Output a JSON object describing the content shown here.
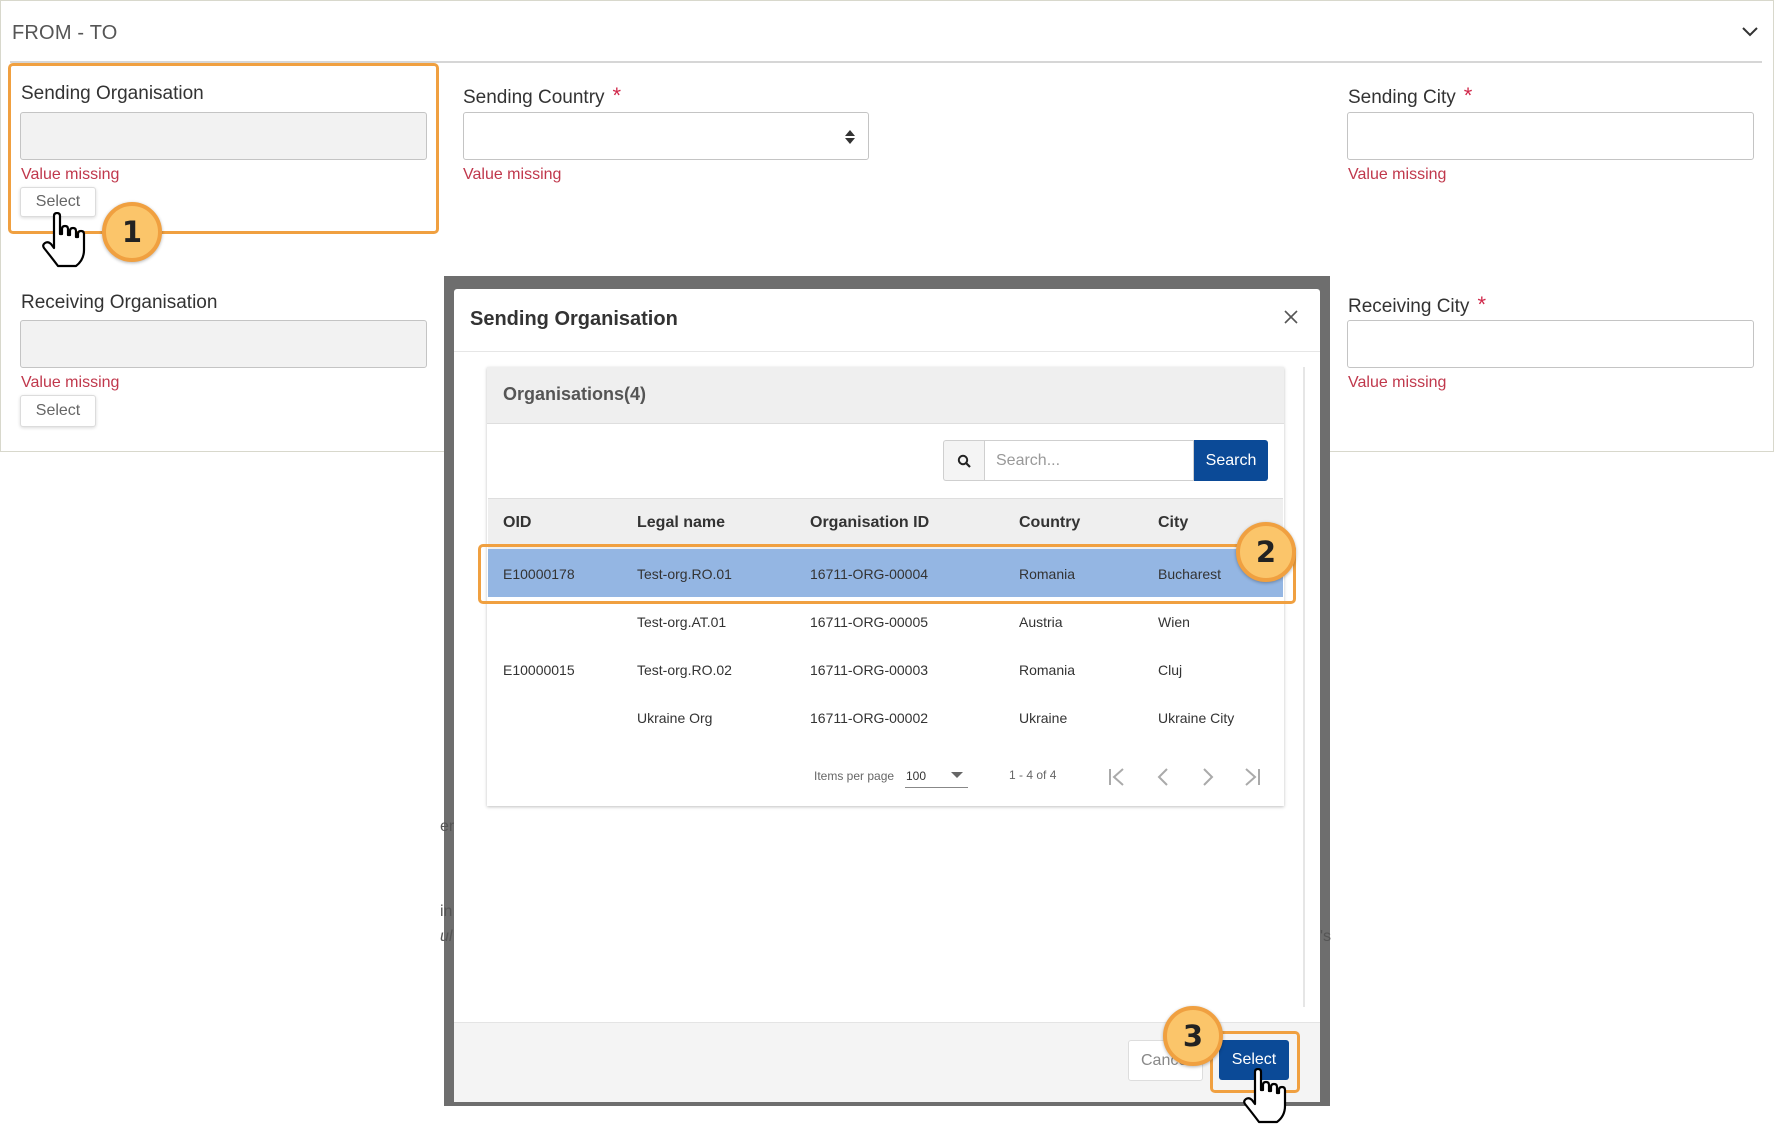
{
  "panel": {
    "title": "FROM - TO",
    "collapse_icon": "chevron-down-icon",
    "fields": {
      "sending_organisation": {
        "label": "Sending Organisation",
        "value": "",
        "error": "Value missing",
        "button": "Select"
      },
      "sending_country": {
        "label": "Sending Country",
        "required": "*",
        "value": "",
        "error": "Value missing"
      },
      "sending_city": {
        "label": "Sending City",
        "required": "*",
        "value": "",
        "error": "Value missing"
      },
      "receiving_organisation": {
        "label": "Receiving Organisation",
        "value": "",
        "error": "Value missing",
        "button": "Select"
      },
      "receiving_city": {
        "label": "Receiving City",
        "required": "*",
        "value": "",
        "error": "Value missing"
      }
    }
  },
  "modal": {
    "title": "Sending Organisation",
    "close_icon": "close-icon",
    "card_title": "Organisations(4)",
    "search": {
      "placeholder": "Search...",
      "value": "",
      "button": "Search",
      "icon": "search-icon"
    },
    "table": {
      "columns": [
        "OID",
        "Legal name",
        "Organisation ID",
        "Country",
        "City"
      ],
      "rows": [
        {
          "oid": "E10000178",
          "legal_name": "Test-org.RO.01",
          "org_id": "16711-ORG-00004",
          "country": "Romania",
          "city": "Bucharest",
          "selected": true
        },
        {
          "oid": "",
          "legal_name": "Test-org.AT.01",
          "org_id": "16711-ORG-00005",
          "country": "Austria",
          "city": "Wien",
          "selected": false
        },
        {
          "oid": "E10000015",
          "legal_name": "Test-org.RO.02",
          "org_id": "16711-ORG-00003",
          "country": "Romania",
          "city": "Cluj",
          "selected": false
        },
        {
          "oid": "",
          "legal_name": "Ukraine Org",
          "org_id": "16711-ORG-00002",
          "country": "Ukraine",
          "city": "Ukraine City",
          "selected": false
        }
      ]
    },
    "pagination": {
      "items_per_page_label": "Items per page",
      "items_per_page": "100",
      "range": "1 - 4 of 4",
      "first_icon": "first-page-icon",
      "prev_icon": "prev-page-icon",
      "next_icon": "next-page-icon",
      "last_icon": "last-page-icon"
    },
    "footer": {
      "cancel": "Cancel",
      "select": "Select"
    }
  },
  "annotations": {
    "step1": "1",
    "step2": "2",
    "step3": "3"
  },
  "background_leaks": {
    "a": "er",
    "b": "in",
    "c": "ul",
    "d": "'s"
  },
  "colors": {
    "primary": "#0b4a97",
    "selected_row": "#94b6e3",
    "error": "#c0384c",
    "required": "#d0284a",
    "annotation": "#f0a040",
    "annotation_fill": "#fbc56a"
  }
}
